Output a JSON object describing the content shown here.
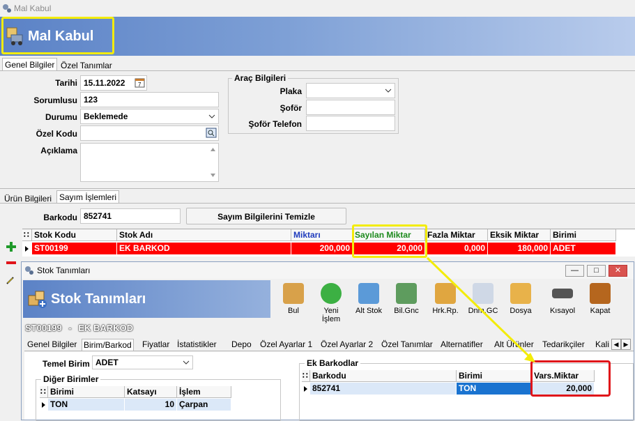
{
  "window": {
    "title": "Mal Kabul"
  },
  "banner": {
    "title": "Mal Kabul"
  },
  "top_tabs": [
    "Genel Bilgiler",
    "Özel Tanımlar"
  ],
  "form": {
    "tarihi_label": "Tarihi",
    "tarihi_value": "15.11.2022",
    "sorumlusu_label": "Sorumlusu",
    "sorumlusu_value": "123",
    "durumu_label": "Durumu",
    "durumu_value": "Beklemede",
    "ozel_kodu_label": "Özel Kodu",
    "ozel_kodu_value": "",
    "aciklama_label": "Açıklama",
    "aciklama_value": ""
  },
  "arac": {
    "title": "Araç Bilgileri",
    "plaka_label": "Plaka",
    "plaka_value": "",
    "sofor_label": "Şoför",
    "sofor_value": "",
    "sofor_tel_label": "Şoför Telefon",
    "sofor_tel_value": ""
  },
  "mid_tabs": [
    "Ürün Bilgileri",
    "Sayım İşlemleri"
  ],
  "barkod": {
    "label": "Barkodu",
    "value": "852741",
    "clear_button": "Sayım Bilgilerini Temizle"
  },
  "main_grid": {
    "headers": [
      "Stok Kodu",
      "Stok Adı",
      "Miktarı",
      "Sayılan Miktar",
      "Fazla Miktar",
      "Eksik Miktar",
      "Birimi"
    ],
    "row": [
      "ST00199",
      "EK BARKOD",
      "200,000",
      "20,000",
      "0,000",
      "180,000",
      "ADET"
    ]
  },
  "child_window": {
    "title": "Stok Tanımları",
    "banner_title": "Stok Tanımları",
    "toolbar": [
      "Bul",
      "Yeni İşlem",
      "Alt Stok",
      "Bil.Gnc",
      "Hrk.Rp.",
      "Dnm.GC",
      "Dosya",
      "Kısayol",
      "Kapat"
    ],
    "record_code": "ST00199",
    "record_sep": "-",
    "record_name": "EK BARKOD",
    "tabs": [
      "Genel Bilgiler",
      "Birim/Barkod",
      "Fiyatlar",
      "İstatistikler",
      "Depo",
      "Özel Ayarlar 1",
      "Özel Ayarlar 2",
      "Özel Tanımlar",
      "Alternatifler",
      "Alt Ürünler",
      "Tedarikçiler",
      "Kali"
    ],
    "temel_birim_label": "Temel Birim",
    "temel_birim_value": "ADET",
    "diger_birimler_title": "Diğer Birimler",
    "diger_headers": [
      "Birimi",
      "Katsayı",
      "İşlem"
    ],
    "diger_row": [
      "TON",
      "10",
      "Çarpan"
    ],
    "ek_barkodlar_title": "Ek Barkodlar",
    "ek_headers": [
      "Barkodu",
      "Birimi",
      "Vars.Miktar"
    ],
    "ek_row": [
      "852741",
      "TON",
      "20,000"
    ]
  },
  "colors": {
    "highlight_yellow": "#f3ec0a",
    "highlight_red": "#e0141a",
    "row_red": "#ff0000",
    "banner_blue": "#5b82c6"
  }
}
